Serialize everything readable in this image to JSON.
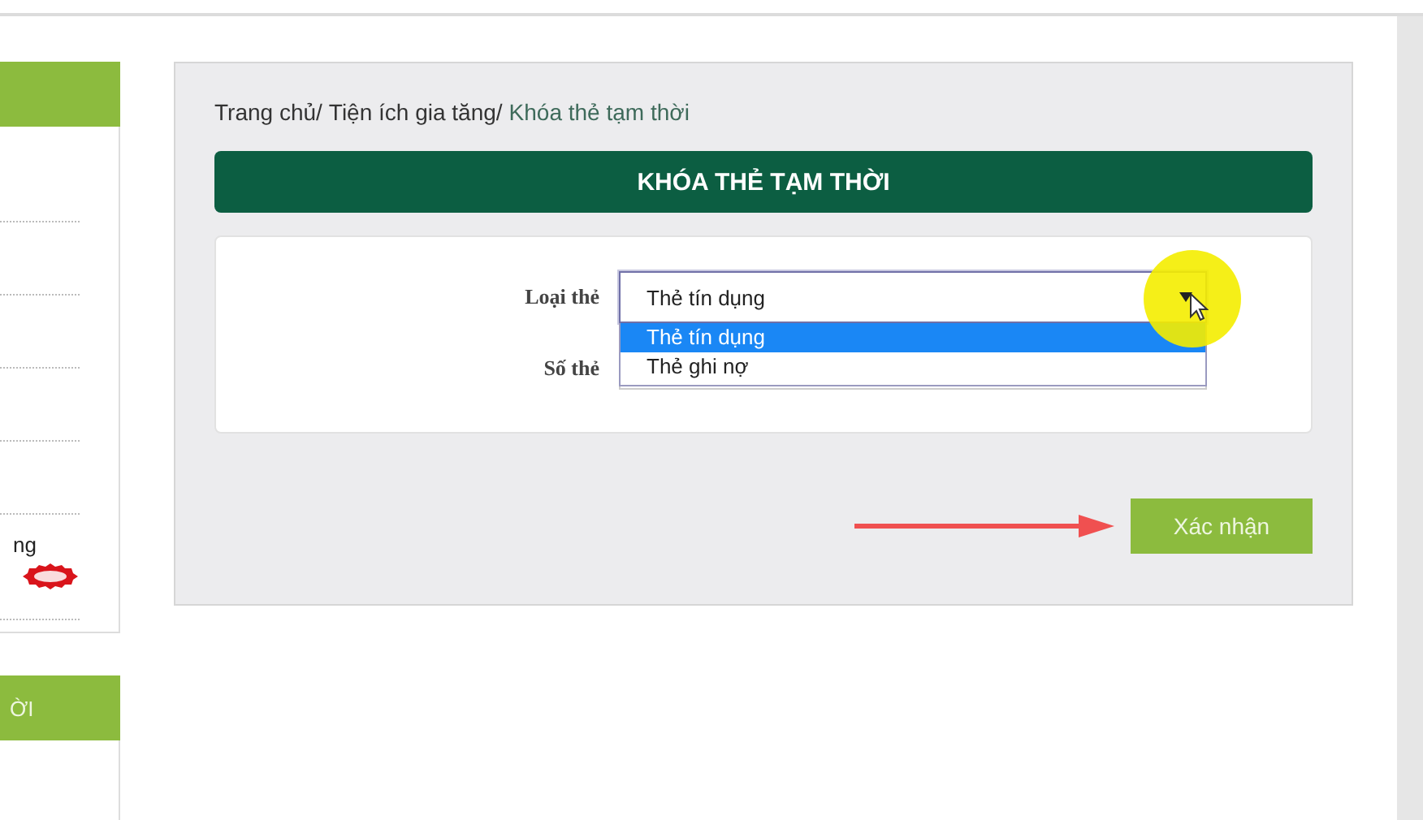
{
  "sidebar": {
    "items": [
      {
        "kind": "line"
      },
      {
        "kind": "line"
      },
      {
        "kind": "line"
      },
      {
        "kind": "line"
      },
      {
        "kind": "line"
      },
      {
        "kind": "text",
        "label": "ng",
        "new_badge": true
      }
    ],
    "section_header": "ỜI"
  },
  "breadcrumb": [
    {
      "label": "Trang chủ/",
      "current": false
    },
    {
      "label": "Tiện ích gia tăng/",
      "current": false
    },
    {
      "label": "Khóa thẻ tạm thời",
      "current": true
    }
  ],
  "title": "KHÓA THẺ TẠM THỜI",
  "form": {
    "card_type": {
      "label": "Loại thẻ",
      "value": "Thẻ tín dụng",
      "expanded": true,
      "options": [
        {
          "label": "Thẻ tín dụng",
          "selected": true
        },
        {
          "label": "Thẻ ghi nợ",
          "selected": false
        }
      ]
    },
    "card_number": {
      "label": "Số thẻ"
    }
  },
  "submit": "Xác nhận"
}
